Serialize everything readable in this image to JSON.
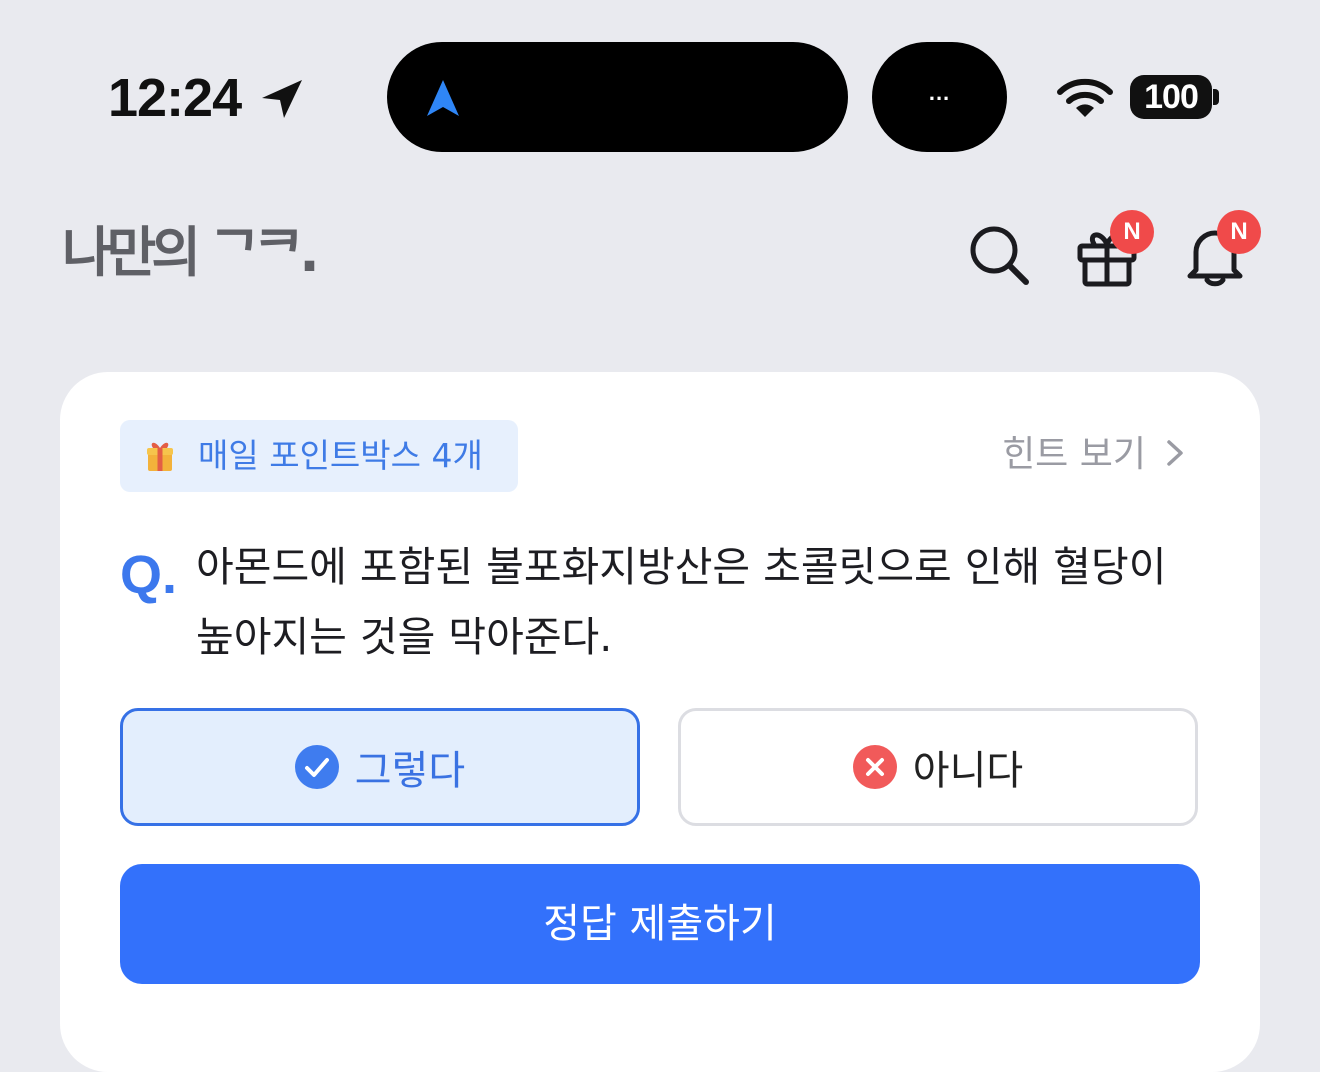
{
  "status_bar": {
    "time": "12:24",
    "island_dots": "...",
    "battery": "100"
  },
  "header": {
    "logo": "나만의 ᄀᄏ.",
    "gift_badge": "N",
    "bell_badge": "N",
    "icons": [
      "search-icon",
      "gift-icon",
      "bell-icon"
    ]
  },
  "quiz": {
    "point_chip": "매일 포인트박스 4개",
    "hint_label": "힌트 보기",
    "q_prefix": "Q.",
    "question": "아몬드에 포함된 불포화지방산은 초콜릿으로 인해 혈당이 높아지는 것을 막아준다.",
    "options": [
      {
        "label": "그렇다",
        "selected": true
      },
      {
        "label": "아니다",
        "selected": false
      }
    ],
    "submit_label": "정답 제출하기"
  },
  "colors": {
    "accent": "#3371fb",
    "badge": "#f04a4a",
    "background": "#e9eaef"
  }
}
